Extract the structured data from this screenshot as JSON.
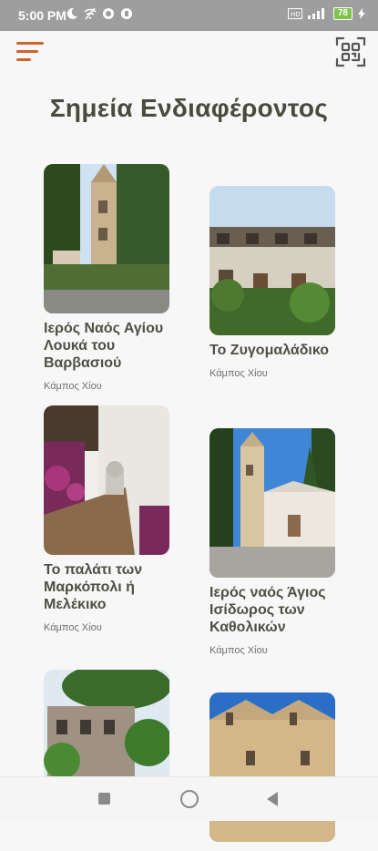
{
  "status_bar": {
    "time": "5:00 PM",
    "battery": "78",
    "left_icons": [
      "moon-icon",
      "wifi-off-icon",
      "app-icon",
      "app-icon-2"
    ],
    "right_icons": [
      "volte-icon",
      "signal-icon",
      "battery-icon",
      "charging-icon"
    ]
  },
  "header": {
    "title": "Σημεία Ενδιαφέροντος",
    "menu_icon": "menu-icon",
    "qr_icon": "qr-scan-icon",
    "accent_color": "#c8662e"
  },
  "cards": [
    {
      "name": "Ιερός Ναός Αγίου Λουκά του Βαρβασιού",
      "location": "Κάμπος Χίου"
    },
    {
      "name": "Το Ζυγομαλάδικο",
      "location": "Κάμπος Χίου"
    },
    {
      "name": "Το παλάτι των Μαρκόπολι ή Μελέκικο",
      "location": "Κάμπος Χίου"
    },
    {
      "name": "Ιερός ναός Άγιος Ισίδωρος των Καθολικών",
      "location": "Κάμπος Χίου"
    },
    {
      "name": "",
      "location": ""
    },
    {
      "name": "",
      "location": ""
    }
  ],
  "nav_bar": {
    "icons": [
      "recents-icon",
      "home-icon",
      "back-icon"
    ]
  }
}
